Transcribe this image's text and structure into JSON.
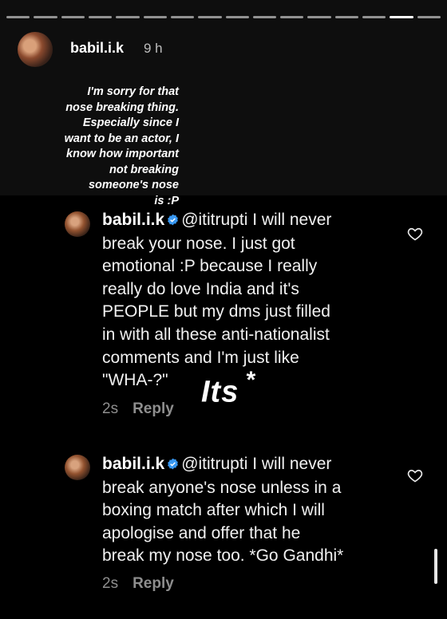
{
  "story": {
    "username": "babil.i.k",
    "time_ago": "9 h",
    "progress_segments": 16,
    "active_segment": 15,
    "caption_lines": [
      "I'm sorry for that",
      "nose breaking thing.",
      "Especially since I",
      "want to be an actor, I",
      "know how important",
      "not breaking",
      "someone's nose",
      "is :P"
    ]
  },
  "comments": [
    {
      "username": "babil.i.k",
      "mention": "@ititrupti",
      "lines": [
        " I will never",
        "break your nose. I just got",
        "emotional :P because I really",
        "really do love India and it's",
        "PEOPLE but my dms just filled",
        "in with all these anti-nationalist",
        "comments and I'm just like",
        "\"WHA-?\""
      ],
      "time": "2s",
      "reply_label": "Reply"
    },
    {
      "username": "babil.i.k",
      "mention": "@ititrupti",
      "lines": [
        " I will never",
        "break anyone's nose unless in a",
        "boxing match after which I will",
        "apologise and offer that he",
        "break my nose too. *Go Gandhi*"
      ],
      "time": "2s",
      "reply_label": "Reply"
    }
  ],
  "sticker": {
    "text": "Its",
    "symbol": "*"
  },
  "colors": {
    "verified": "#3897f0",
    "meta_text": "#8e8e8e"
  }
}
